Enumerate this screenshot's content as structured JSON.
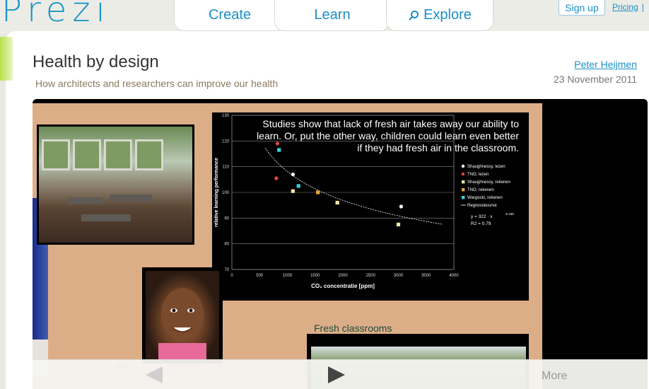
{
  "header": {
    "logo": "Prezi",
    "tabs": [
      {
        "label": "Create"
      },
      {
        "label": "Learn"
      },
      {
        "label": "Explore"
      }
    ],
    "signup_label": "Sign up",
    "pricing_label": "Pricing",
    "cut_link_label": "l"
  },
  "presentation": {
    "title": "Health by design",
    "subtitle": "How architects and researchers can improve our health",
    "author": "Peter Heijmen",
    "date": "23 November 2011"
  },
  "canvas": {
    "chart_caption": "Studies show that lack of fresh air takes away our ability to learn. Or, put the other way, children could learn even better if they had fresh air in the classroom.",
    "fresh_title": "Fresh classrooms",
    "stray_text": "co"
  },
  "chart_data": {
    "type": "scatter",
    "xlabel": "CO₂ concentratie [ppm]",
    "ylabel": "relative learning performance",
    "xlim": [
      0,
      4000
    ],
    "ylim": [
      70,
      130
    ],
    "x_ticks": [
      "0",
      "500",
      "1000",
      "1500",
      "2000",
      "2500",
      "3000",
      "3500",
      "4000"
    ],
    "y_ticks": [
      "70",
      "80",
      "90",
      "100",
      "110",
      "120",
      "130"
    ],
    "grid": true,
    "legend_position": "right",
    "series": [
      {
        "name": "Shaughnessy, lezen",
        "color": "#ffffff",
        "points": [
          [
            1100,
            107
          ],
          [
            3050,
            94.5
          ]
        ]
      },
      {
        "name": "TNO, lezen",
        "color": "#e84a3a",
        "points": [
          [
            800,
            105.5
          ],
          [
            820,
            119
          ]
        ]
      },
      {
        "name": "Shaughnessy, rekenen",
        "color": "#f2e8a6",
        "points": [
          [
            1100,
            100.5
          ],
          [
            1900,
            96
          ],
          [
            3000,
            87.5
          ]
        ]
      },
      {
        "name": "TNO, rekenen",
        "color": "#e8a63a",
        "points": [
          [
            1550,
            100
          ]
        ]
      },
      {
        "name": "Wargocki, rekenen",
        "color": "#3ad2e0",
        "points": [
          [
            850,
            116.5
          ],
          [
            1200,
            102.5
          ]
        ]
      }
    ],
    "regression": {
      "name": "Regressiecurve",
      "equation": "y = 322 · x",
      "exponent": "-0.158",
      "r2": "R2 = 0.79",
      "x_range": [
        600,
        3800
      ]
    }
  },
  "viewer_nav": {
    "more_label": "More"
  }
}
